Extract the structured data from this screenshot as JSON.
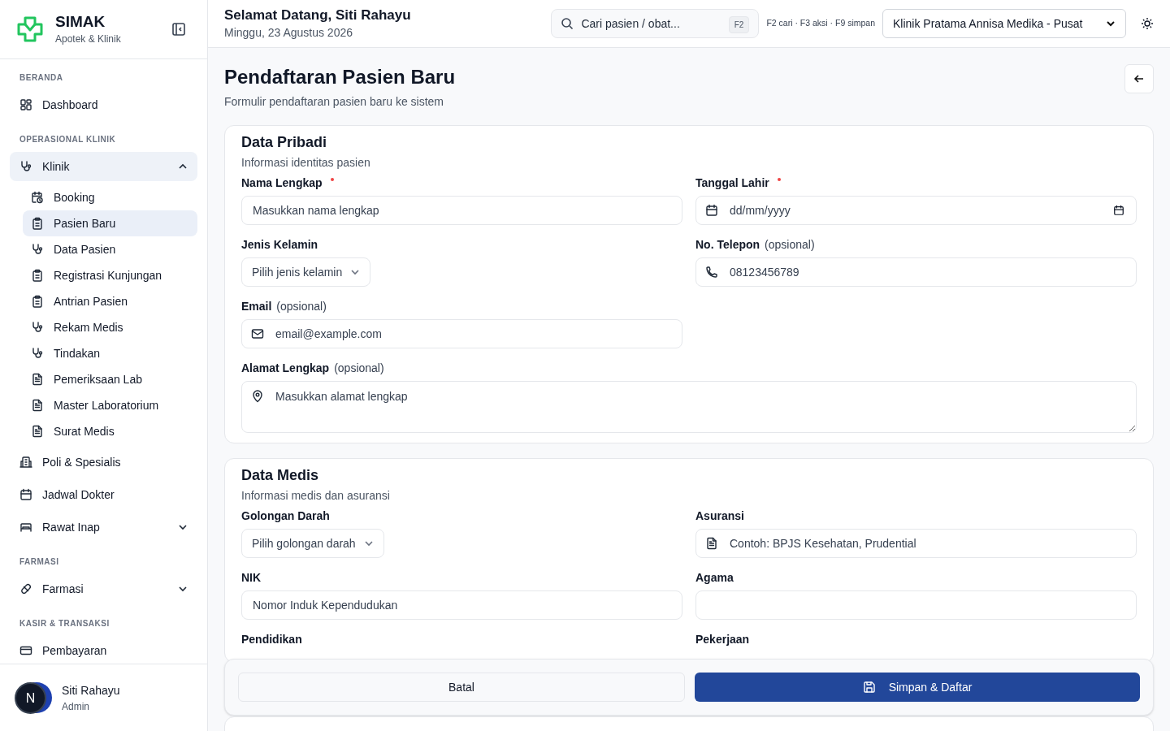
{
  "sidebar": {
    "brand": {
      "name": "SIMAK",
      "subtitle": "Apotek & Klinik"
    },
    "sections": [
      {
        "title": "BERANDA",
        "items": [
          {
            "label": "Dashboard",
            "selected": false
          }
        ]
      },
      {
        "title": "OPERASIONAL KLINIK",
        "items": [
          {
            "label": "Klinik",
            "selected": false,
            "expanded": true,
            "children": [
              {
                "label": "Booking",
                "selected": false
              },
              {
                "label": "Pasien Baru",
                "selected": true
              },
              {
                "label": "Data Pasien",
                "selected": false
              },
              {
                "label": "Registrasi Kunjungan",
                "selected": false
              },
              {
                "label": "Antrian Pasien",
                "selected": false
              },
              {
                "label": "Rekam Medis",
                "selected": false
              },
              {
                "label": "Tindakan",
                "selected": false
              },
              {
                "label": "Pemeriksaan Lab",
                "selected": false
              },
              {
                "label": "Master Laboratorium",
                "selected": false
              },
              {
                "label": "Surat Medis",
                "selected": false
              }
            ]
          },
          {
            "label": "Poli & Spesialis",
            "selected": false
          },
          {
            "label": "Jadwal Dokter",
            "selected": false
          },
          {
            "label": "Rawat Inap",
            "selected": false,
            "expanded": false
          }
        ]
      },
      {
        "title": "FARMASI",
        "items": [
          {
            "label": "Farmasi",
            "selected": false,
            "expanded": false
          }
        ]
      },
      {
        "title": "KASIR & TRANSAKSI",
        "items": [
          {
            "label": "Pembayaran",
            "selected": false
          }
        ]
      }
    ],
    "user": {
      "initial": "N",
      "name": "Siti Rahayu",
      "role": "Admin"
    }
  },
  "header": {
    "greeting": "Selamat Datang, Siti Rahayu",
    "date": "Minggu, 23 Agustus 2026",
    "search": {
      "placeholder": "Cari pasien / obat...",
      "shortcut": "F2"
    },
    "hint": "F2 cari · F3 aksi · F9 simpan",
    "clinic": "Klinik Pratama Annisa Medika - Pusat"
  },
  "page": {
    "title": "Pendaftaran Pasien Baru",
    "subtitle": "Formulir pendaftaran pasien baru ke sistem"
  },
  "sections": [
    {
      "title": "Data Pribadi",
      "subtitle": "Informasi identitas pasien",
      "fields": [
        {
          "label": "Nama Lengkap",
          "required": true,
          "kind": "text",
          "placeholder": "Masukkan nama lengkap"
        },
        {
          "label": "Tanggal Lahir",
          "required": true,
          "kind": "date",
          "placeholder": "dd/mm/yyyy"
        },
        {
          "label": "Jenis Kelamin",
          "kind": "select",
          "placeholder": "Pilih jenis kelamin"
        },
        {
          "label": "No. Telepon",
          "note": "(opsional)",
          "kind": "phone",
          "placeholder": "08123456789"
        },
        {
          "label": "Email",
          "note": "(opsional)",
          "kind": "email",
          "placeholder": "email@example.com"
        },
        {
          "kind": "spacer"
        },
        {
          "label": "Alamat Lengkap",
          "note": "(opsional)",
          "kind": "address",
          "placeholder": "Masukkan alamat lengkap"
        }
      ]
    },
    {
      "title": "Data Medis",
      "subtitle": "Informasi medis dan asuransi",
      "fields": [
        {
          "label": "Golongan Darah",
          "kind": "select",
          "placeholder": "Pilih golongan darah"
        },
        {
          "label": "Asuransi",
          "kind": "insurance",
          "placeholder": "Contoh: BPJS Kesehatan, Prudential"
        },
        {
          "label": "NIK",
          "kind": "text",
          "placeholder": "Nomor Induk Kependudukan"
        },
        {
          "label": "Agama",
          "kind": "text"
        },
        {
          "label": "Pendidikan",
          "kind": "covered"
        },
        {
          "label": "Pekerjaan",
          "kind": "covered"
        }
      ]
    }
  ],
  "actions": [
    {
      "label": "Batal",
      "kind": "secondary"
    },
    {
      "label": "Simpan & Daftar",
      "kind": "primary"
    }
  ]
}
